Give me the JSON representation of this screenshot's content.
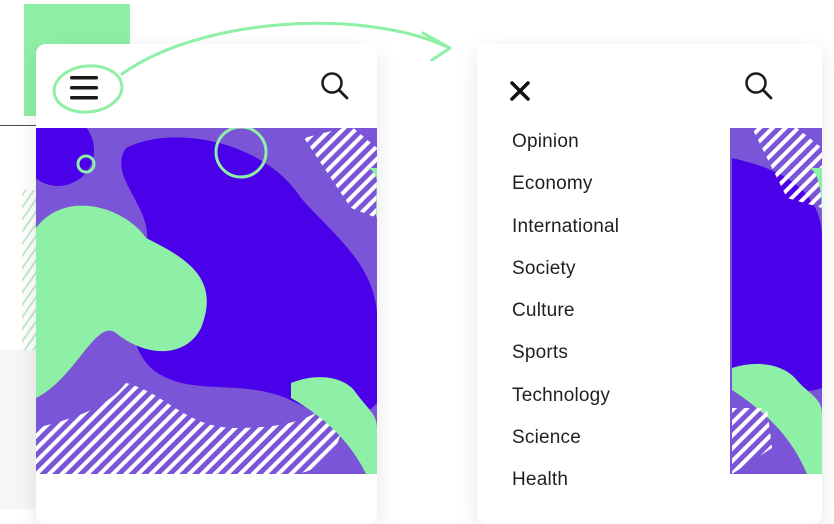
{
  "colors": {
    "accent_green": "#8ef0a6",
    "hero_purple": "#7b55d8",
    "hero_indigo": "#4b00ea",
    "text_dark": "#1f1f1f"
  },
  "icons": {
    "menu": "hamburger-icon",
    "search": "search-icon",
    "close": "close-icon",
    "arrow": "curved-arrow-icon"
  },
  "menu": {
    "items": [
      {
        "label": "Opinion"
      },
      {
        "label": "Economy"
      },
      {
        "label": "International"
      },
      {
        "label": "Society"
      },
      {
        "label": "Culture"
      },
      {
        "label": "Sports"
      },
      {
        "label": "Technology"
      },
      {
        "label": "Science"
      },
      {
        "label": "Health"
      }
    ]
  }
}
